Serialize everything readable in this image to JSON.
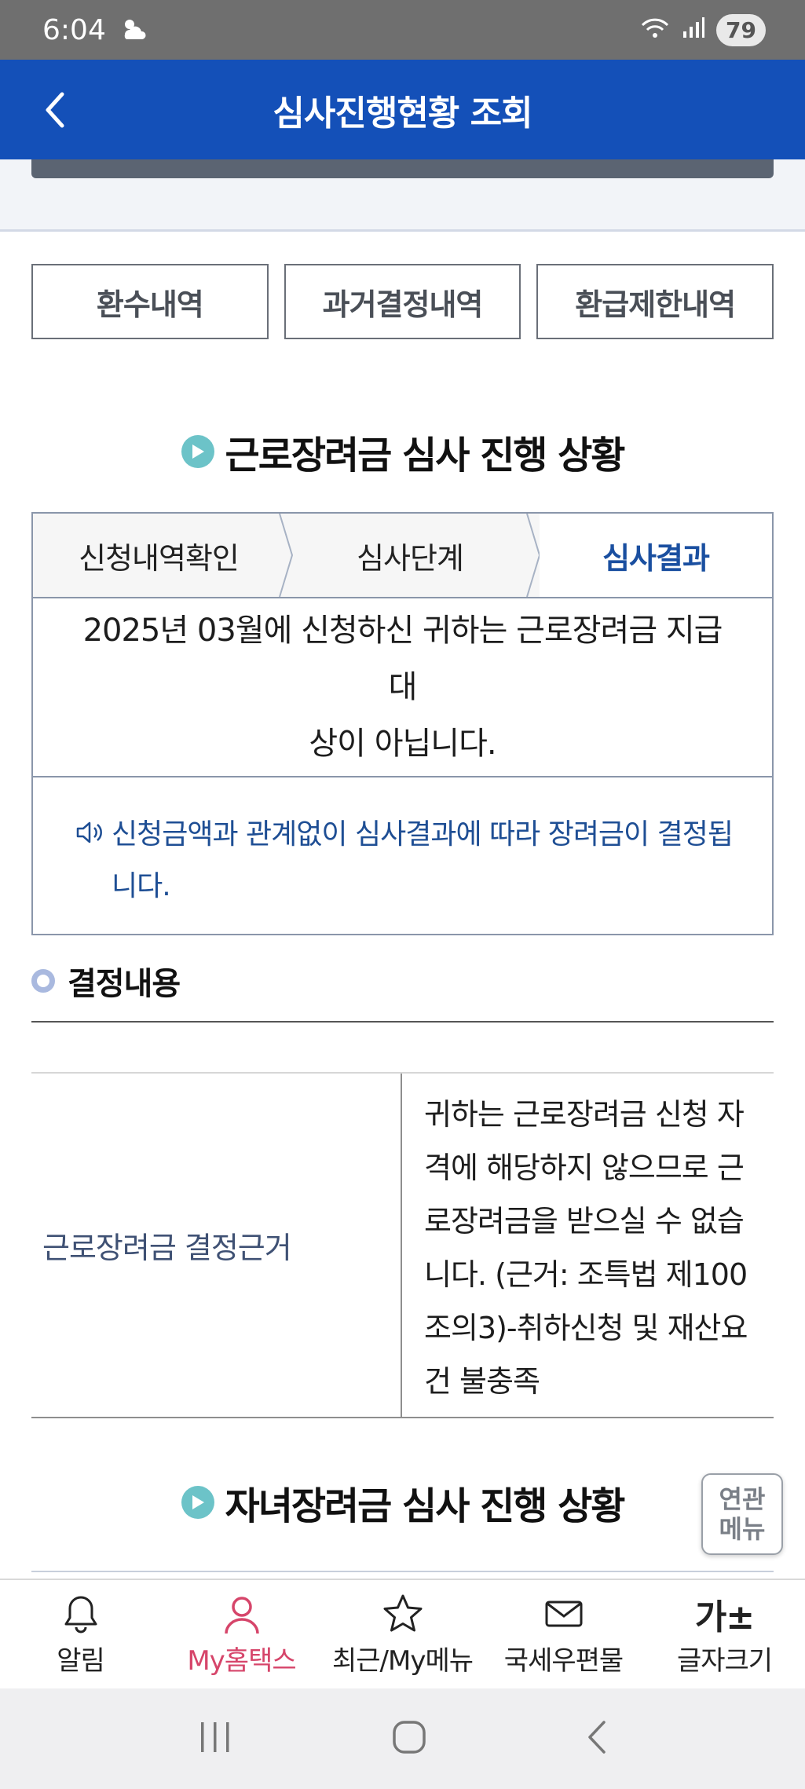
{
  "status": {
    "time": "6:04",
    "battery": "79"
  },
  "header": {
    "title": "심사진행현황 조회"
  },
  "top_buttons": [
    "환수내역",
    "과거결정내역",
    "환급제한내역"
  ],
  "earned_section": {
    "title": "근로장려금 심사 진행 상황",
    "steps": [
      "신청내역확인",
      "심사단계",
      "심사결과"
    ],
    "result_line1": "2025년 03월에 신청하신 귀하는 근로장려금 지급대",
    "result_line2": "상이 아닙니다.",
    "notice": "신청금액과 관계없이 심사결과에 따라 장려금이 결정됩니다."
  },
  "decision": {
    "heading": "결정내용",
    "label": "근로장려금 결정근거",
    "value": "귀하는 근로장려금 신청 자격에 해당하지 않으므로 근로장려금을 받으실 수 없습니다. (근거: 조특법 제100조의3)-취하신청 및 재산요건 불충족"
  },
  "child_section": {
    "title": "자녀장려금 심사 진행 상황"
  },
  "related_menu": {
    "line1": "연관",
    "line2": "메뉴"
  },
  "bottom_nav": [
    {
      "label": "알림",
      "icon": "bell-icon"
    },
    {
      "label": "My홈택스",
      "icon": "person-icon"
    },
    {
      "label": "최근/My메뉴",
      "icon": "star-icon"
    },
    {
      "label": "국세우편물",
      "icon": "mail-icon"
    },
    {
      "label": "글자크기",
      "icon": "font-size-icon",
      "glyph": "가±"
    }
  ],
  "colors": {
    "header_blue": "#1450b8",
    "active_step": "#1a4fa0",
    "nav_active": "#d6456a",
    "teal_dot": "#6cc3c8"
  }
}
